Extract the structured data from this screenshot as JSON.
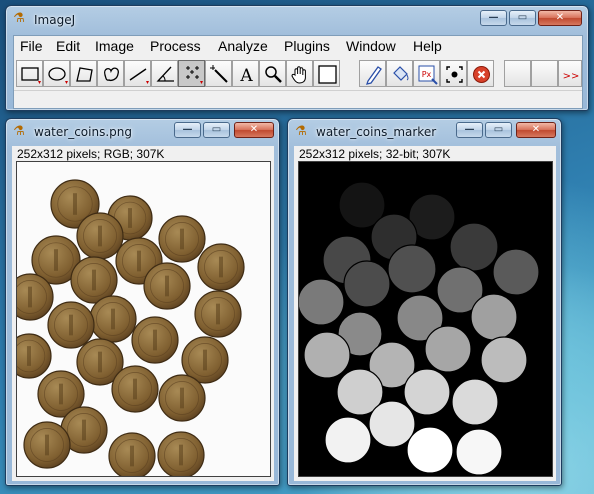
{
  "colors": {
    "accent": "#1c3c5e",
    "coin": "#8a6a38",
    "close": "#c04a30"
  },
  "main_window": {
    "title": "ImageJ",
    "menu": [
      "File",
      "Edit",
      "Image",
      "Process",
      "Analyze",
      "Plugins",
      "Window",
      "Help"
    ],
    "tools": [
      "rectangle-selection-icon",
      "oval-selection-icon",
      "polygon-selection-icon",
      "freehand-selection-icon",
      "line-selection-icon",
      "angle-tool-icon",
      "multipoint-tool-icon",
      "wand-tool-icon",
      "text-tool-icon",
      "magnifier-icon",
      "hand-scroll-icon",
      "color-picker-icon",
      "pencil-icon",
      "flood-fill-icon",
      "pixel-inspector-icon",
      "roi-icon",
      "stop-icon",
      "more-tools-icon"
    ],
    "tool_labels": {
      "text": "A",
      "pixel": "Px",
      "more": ">>"
    },
    "status_text": ""
  },
  "window_left": {
    "title": "water_coins.png",
    "info": "252x312 pixels; RGB; 307K"
  },
  "window_right": {
    "title": "water_coins_marker",
    "info": "252x312 pixels; 32-bit; 307K"
  },
  "caption_buttons": {
    "minimize": "—",
    "maximize": "▭",
    "close": "✕"
  }
}
